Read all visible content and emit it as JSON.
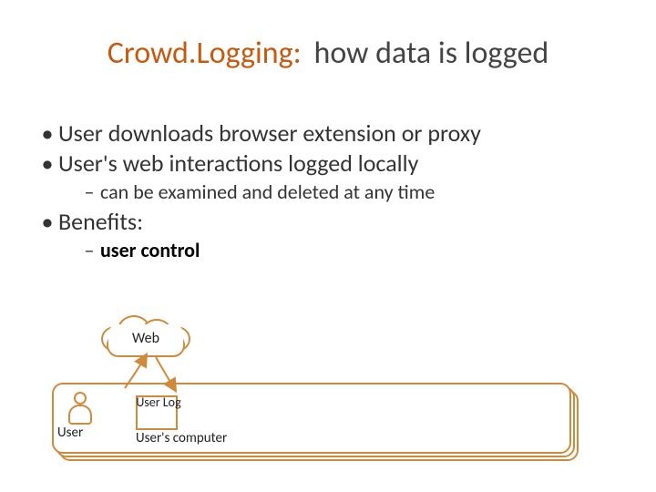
{
  "title": {
    "accent": "Crowd.Logging:",
    "rest": "how data is logged"
  },
  "bullets": {
    "b1": "User downloads browser extension or proxy",
    "b2": "User's web interactions logged locally",
    "b2_sub": "can be examined and deleted at any time",
    "b3": "Benefits:",
    "b3_sub": "user control"
  },
  "diagram": {
    "cloud_label": "Web",
    "user_label": "User",
    "log_label": "User Log",
    "computer_label": "User's computer"
  }
}
